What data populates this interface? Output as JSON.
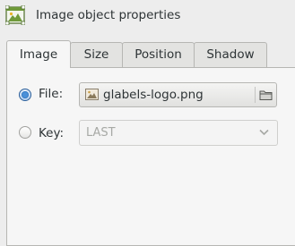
{
  "window": {
    "title": "Image object properties",
    "icon": "image-object-icon"
  },
  "tabs": [
    {
      "label": "Image",
      "active": true
    },
    {
      "label": "Size",
      "active": false
    },
    {
      "label": "Position",
      "active": false
    },
    {
      "label": "Shadow",
      "active": false
    }
  ],
  "image_tab": {
    "file_radio": {
      "label": "File:",
      "checked": true
    },
    "file_chooser": {
      "value": "glabels-logo.png",
      "icon": "image-file-icon",
      "browse_icon": "folder-icon"
    },
    "key_radio": {
      "label": "Key:",
      "checked": false
    },
    "key_combo": {
      "value": "LAST",
      "enabled": false,
      "icon": "chevron-down-icon"
    }
  }
}
